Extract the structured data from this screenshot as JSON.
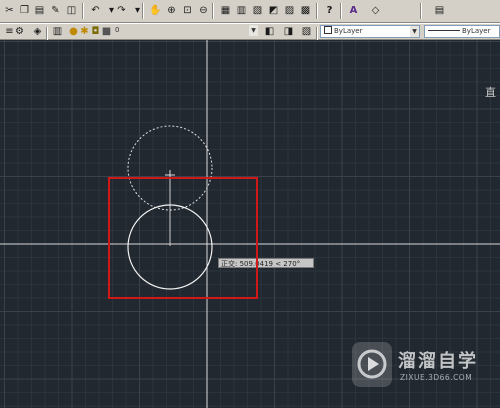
{
  "toolbar": {
    "layer_value": "0",
    "color_value": "ByLayer",
    "linetype_value": "ByLayer"
  },
  "tooltip": {
    "text": "正交: 50⁠9.0419 < 270°"
  },
  "watermark": {
    "title": "溜溜自学",
    "url": "ZIXUE.3D66.COM"
  },
  "colors": {
    "canvas_bg": "#212830",
    "grid_minor": "#2b333c",
    "grid_major": "#39424c",
    "highlight": "#d01818"
  }
}
